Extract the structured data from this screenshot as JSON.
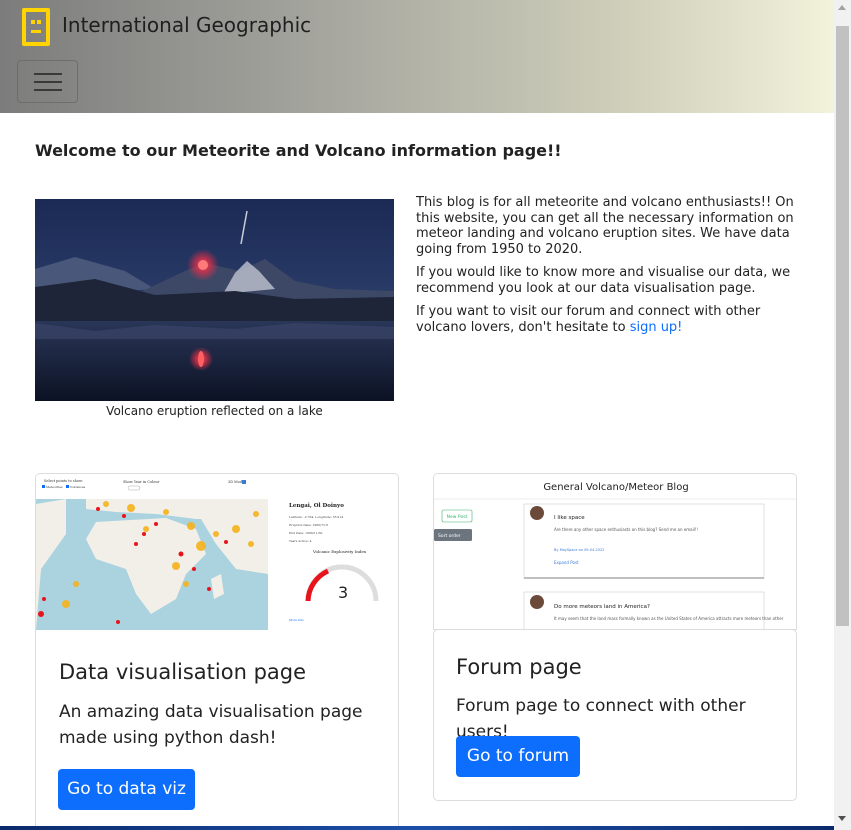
{
  "navbar": {
    "brand": "International Geographic",
    "logo_icon": "face-logo-icon",
    "toggler_icon": "hamburger-menu-icon",
    "accent_color": "#ffd400"
  },
  "main": {
    "welcome_title": "Welcome to our Meteorite and Volcano information page!!",
    "hero_caption": "Volcano eruption reflected on a lake",
    "paragraph1": "This blog is for all meteorite and volcano enthusiasts!! On this website, you can get all the necessary information on meteor landing and volcano eruption sites. We have data going from 1950 to 2020.",
    "paragraph2": "If you would like to know more and visualise our data, we recommend you look at our data visualisation page.",
    "paragraph3_prefix": "If you want to visit our forum and connect with other volcano lovers, don't hesitate to ",
    "signup_link": "sign up!"
  },
  "cards": {
    "dataviz": {
      "title": "Data visualisation page",
      "text": "An amazing data visualisation page made using python dash!",
      "button": "Go to data viz",
      "thumb": {
        "legend_label": "Select points to show:",
        "legend_meteorites": "Meteorites",
        "legend_volcanoes": "Volcanoes",
        "toggle_label": "Show Year in Colour",
        "checkbox_label": "3D Mode",
        "location": "Lengai, Ol Doinyo",
        "info_lines": [
          "Latitude: -2.764, Longitude: 35.914",
          "Eruption Date: 1966/7/18",
          "End Date: 1966/11/30",
          "Years Active: 4"
        ],
        "gauge_title": "Volcanic Explosivity Index",
        "gauge_value": "3",
        "more_link": "More Info"
      }
    },
    "forum": {
      "title": "Forum page",
      "text": "Forum page to connect with other users!",
      "button": "Go to forum",
      "thumb": {
        "header": "General Volcano/Meteor Blog",
        "new_post": "New Post",
        "sort_order": "Sort order",
        "post1_title": "I like space",
        "post1_body": "Are there any other space enthusiasts on this blog? Send me an email!!",
        "post1_meta": "By MaySpace on 09-04-2022",
        "post1_link": "Expand Post",
        "post2_title": "Do more meteors land in America?",
        "post2_body": "It may seem that the land mass formally known as the United States of America attracts more meteors than other"
      }
    }
  },
  "colors": {
    "primary": "#0d6efd",
    "meteorite": "#e8141c",
    "volcano": "#f6b21b"
  }
}
